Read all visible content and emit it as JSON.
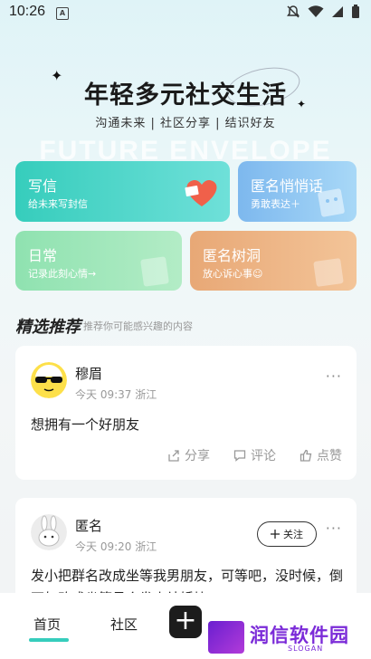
{
  "status_bar": {
    "time": "10:26",
    "notif_icon": "A"
  },
  "hero": {
    "title": "年轻多元社交生活",
    "subtitle": "沟通未来 | 社区分享 | 结识好友",
    "watermark": "FUTURE ENVELOPE"
  },
  "cards": [
    {
      "title": "写信",
      "subtitle": "给未来写封信"
    },
    {
      "title": "匿名悄悄话",
      "subtitle": "勇敢表达＋"
    },
    {
      "title": "日常",
      "subtitle": "记录此刻心情→"
    },
    {
      "title": "匿名树洞",
      "subtitle": "放心诉心事☺"
    }
  ],
  "section": {
    "title": "精选推荐",
    "subtitle": "推荐你可能感兴趣的内容"
  },
  "posts": [
    {
      "user": "穆眉",
      "meta": "今天 09:37 浙江",
      "content": "想拥有一个好朋友",
      "more": "···",
      "share": "分享",
      "comment": "评论",
      "like": "点赞"
    },
    {
      "user": "匿名",
      "meta": "今天 09:20 浙江",
      "follow": "关注",
      "more": "···",
      "content": "发小把群名改成坐等我男朋友，可等吧，没时候，倒不如改成坐等员个发小结婚块"
    }
  ],
  "tabbar": {
    "home": "首页",
    "community": "社区",
    "plus": "+"
  },
  "brand": {
    "name": "润信软件园",
    "slogan": "SLOGAN"
  }
}
